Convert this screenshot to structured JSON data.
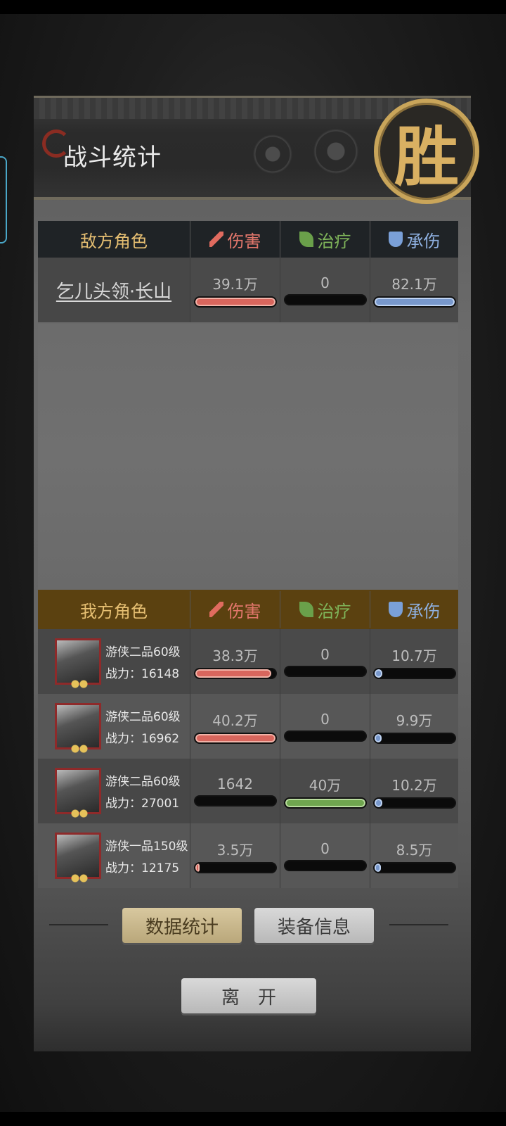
{
  "header": {
    "title": "战斗统计",
    "seal": "胜"
  },
  "columns": {
    "damage": "伤害",
    "heal": "治疗",
    "taken": "承伤"
  },
  "enemy": {
    "label": "敌方角色",
    "rows": [
      {
        "name": "乞儿头领·长山",
        "damage": "39.1万",
        "damage_pct": 1.0,
        "heal": "0",
        "heal_pct": 0,
        "taken": "82.1万",
        "taken_pct": 1.0
      }
    ]
  },
  "ally": {
    "label": "我方角色",
    "rows": [
      {
        "rank": "游侠二品60级",
        "power_label": "战力：16148",
        "damage": "38.3万",
        "damage_pct": 0.95,
        "heal": "0",
        "heal_pct": 0,
        "taken": "10.7万",
        "taken_pct": 0.1
      },
      {
        "rank": "游侠二品60级",
        "power_label": "战力：16962",
        "damage": "40.2万",
        "damage_pct": 1.0,
        "heal": "0",
        "heal_pct": 0,
        "taken": "9.9万",
        "taken_pct": 0.09
      },
      {
        "rank": "游侠二品60级",
        "power_label": "战力：27001",
        "damage": "1642",
        "damage_pct": 0.0,
        "heal": "40万",
        "heal_pct": 1.0,
        "taken": "10.2万",
        "taken_pct": 0.1
      },
      {
        "rank": "游侠一品150级",
        "power_label": "战力：12175",
        "damage": "3.5万",
        "damage_pct": 0.05,
        "heal": "0",
        "heal_pct": 0,
        "taken": "8.5万",
        "taken_pct": 0.08
      }
    ]
  },
  "buttons": {
    "stats": "数据统计",
    "equip": "装备信息",
    "leave": "离　开"
  },
  "colors": {
    "damage": "#d8665d",
    "heal": "#6fa54f",
    "taken": "#7898cc"
  }
}
